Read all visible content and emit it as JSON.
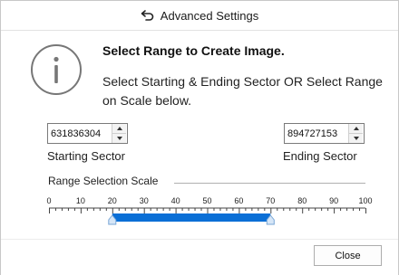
{
  "window": {
    "title": "Advanced Settings",
    "title_icon": "back-arrow-icon"
  },
  "dialog": {
    "heading": "Select Range to Create Image.",
    "description": "Select Starting & Ending Sector OR Select Range on Scale below.",
    "info_icon": "info-icon"
  },
  "start": {
    "value": "631836304",
    "label": "Starting Sector"
  },
  "end": {
    "value": "894727153",
    "label": "Ending Sector"
  },
  "scale": {
    "label": "Range Selection Scale",
    "min": 0,
    "max": 100,
    "ticks": [
      "0",
      "10",
      "20",
      "30",
      "40",
      "50",
      "60",
      "70",
      "80",
      "90",
      "100"
    ],
    "range_start": 20,
    "range_end": 70,
    "range_color": "#0a6fd6"
  },
  "buttons": {
    "close": "Close"
  }
}
